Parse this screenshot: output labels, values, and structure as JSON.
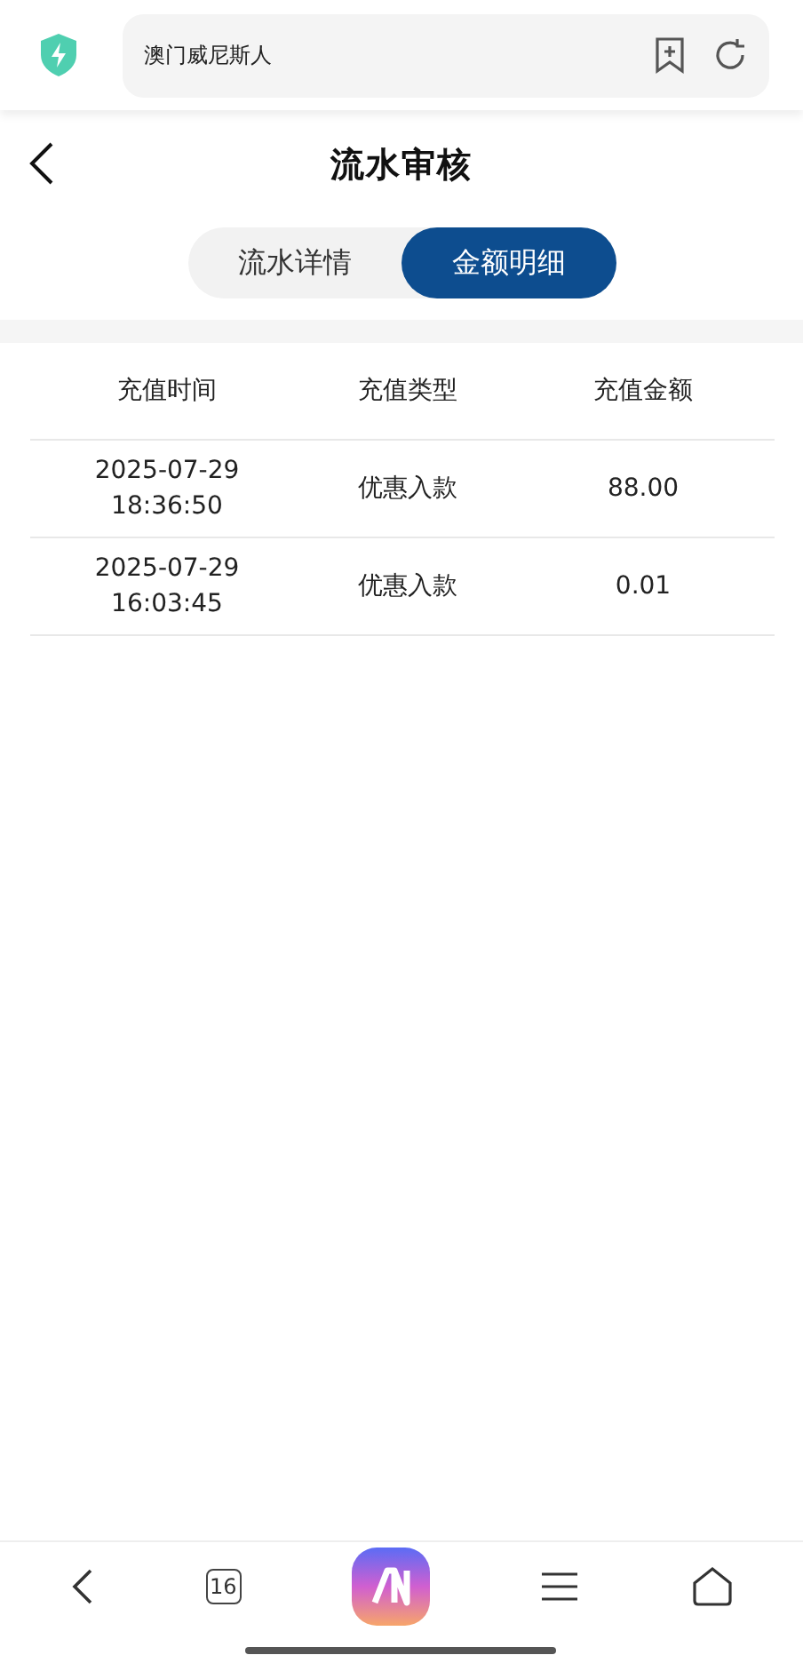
{
  "browser": {
    "address": "澳门威尼斯人"
  },
  "header": {
    "title": "流水审核"
  },
  "tabs": [
    {
      "label": "流水详情",
      "selected": false
    },
    {
      "label": "金额明细",
      "selected": true
    }
  ],
  "table": {
    "columns": [
      "充值时间",
      "充值类型",
      "充值金额"
    ],
    "rows": [
      {
        "time": [
          "2025-07-29",
          "18:36:50"
        ],
        "type": "优惠入款",
        "amount": "88.00"
      },
      {
        "time": [
          "2025-07-29",
          "16:03:45"
        ],
        "type": "优惠入款",
        "amount": "0.01"
      }
    ]
  },
  "bottom_nav": {
    "tab_count": "16"
  }
}
